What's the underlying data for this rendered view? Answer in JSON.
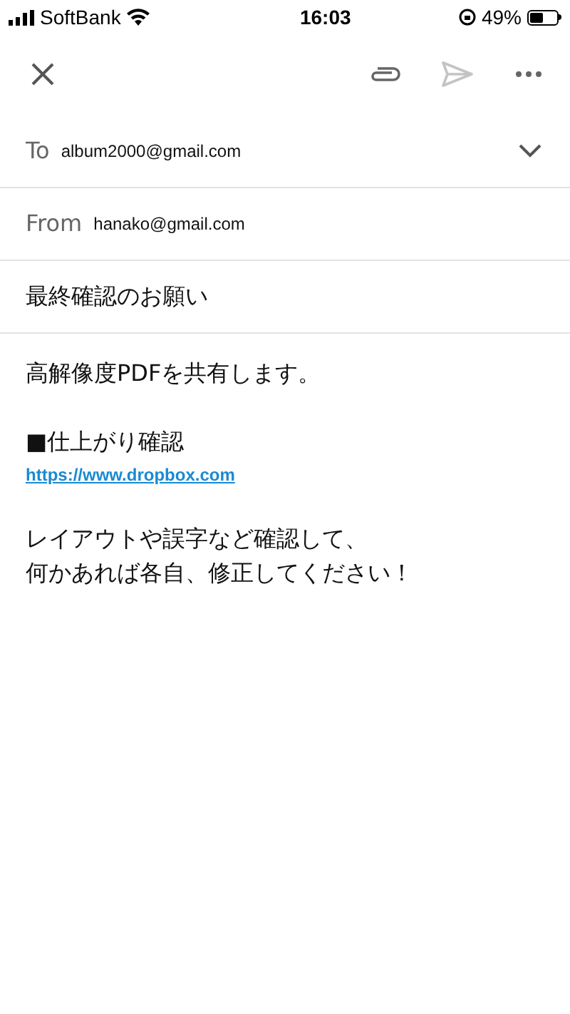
{
  "status_bar": {
    "carrier": "SoftBank",
    "time": "16:03",
    "battery_percent": "49%"
  },
  "toolbar": {
    "send_disabled": true
  },
  "to": {
    "label": "To",
    "value": "album2000@gmail.com"
  },
  "from": {
    "label": "From",
    "value": "hanako@gmail.com"
  },
  "subject": "最終確認のお願い",
  "body": [
    {
      "kind": "text",
      "text": "高解像度PDFを共有します。"
    },
    {
      "kind": "gap"
    },
    {
      "kind": "text",
      "text": "■仕上がり確認"
    },
    {
      "kind": "link",
      "text": "https://www.dropbox.com"
    },
    {
      "kind": "gap"
    },
    {
      "kind": "text",
      "text": "レイアウトや誤字など確認して、"
    },
    {
      "kind": "text",
      "text": "何かあれば各自、修正してください！"
    }
  ]
}
